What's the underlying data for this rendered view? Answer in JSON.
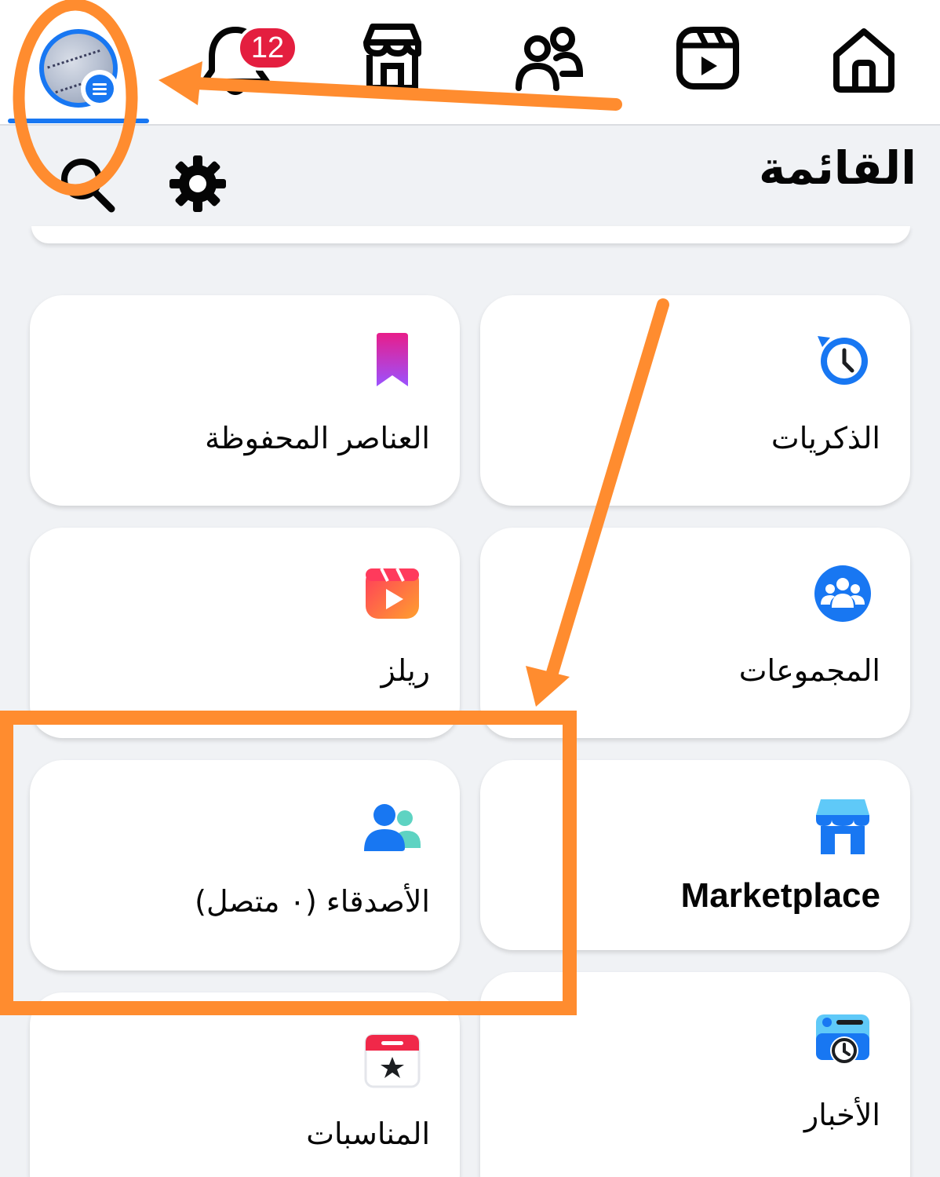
{
  "top_nav": {
    "tabs": [
      {
        "name": "menu",
        "icon": "profile-avatar"
      },
      {
        "name": "notifications",
        "icon": "bell-icon",
        "badge": "12"
      },
      {
        "name": "marketplace",
        "icon": "shop-icon"
      },
      {
        "name": "friends",
        "icon": "friends-icon"
      },
      {
        "name": "video",
        "icon": "video-icon"
      },
      {
        "name": "home",
        "icon": "home-icon"
      }
    ],
    "notifications_badge": "12",
    "active_tab": "menu",
    "accent_color": "#1877f2"
  },
  "header": {
    "title": "القائمة",
    "search_icon": "search-icon",
    "settings_icon": "gear-icon"
  },
  "shortcuts": [
    {
      "id": "memories",
      "label": "الذكريات",
      "icon": "memories-clock-icon"
    },
    {
      "id": "saved",
      "label": "العناصر المحفوظة",
      "icon": "bookmark-icon"
    },
    {
      "id": "groups",
      "label": "المجموعات",
      "icon": "groups-icon"
    },
    {
      "id": "reels",
      "label": "ريلز",
      "icon": "reels-icon"
    },
    {
      "id": "marketplace",
      "label": "Marketplace",
      "icon": "marketplace-store-icon"
    },
    {
      "id": "friends",
      "label": "الأصدقاء (٠ متصل)",
      "icon": "friends-icon"
    },
    {
      "id": "feeds",
      "label": "الأخبار",
      "icon": "feeds-icon"
    },
    {
      "id": "events",
      "label": "المناسبات",
      "icon": "calendar-star-icon"
    }
  ],
  "annotations": {
    "color": "#ff8c2f",
    "shapes": [
      "circle-around-avatar",
      "arrow-to-avatar",
      "arrow-to-friends",
      "box-around-friends"
    ]
  }
}
